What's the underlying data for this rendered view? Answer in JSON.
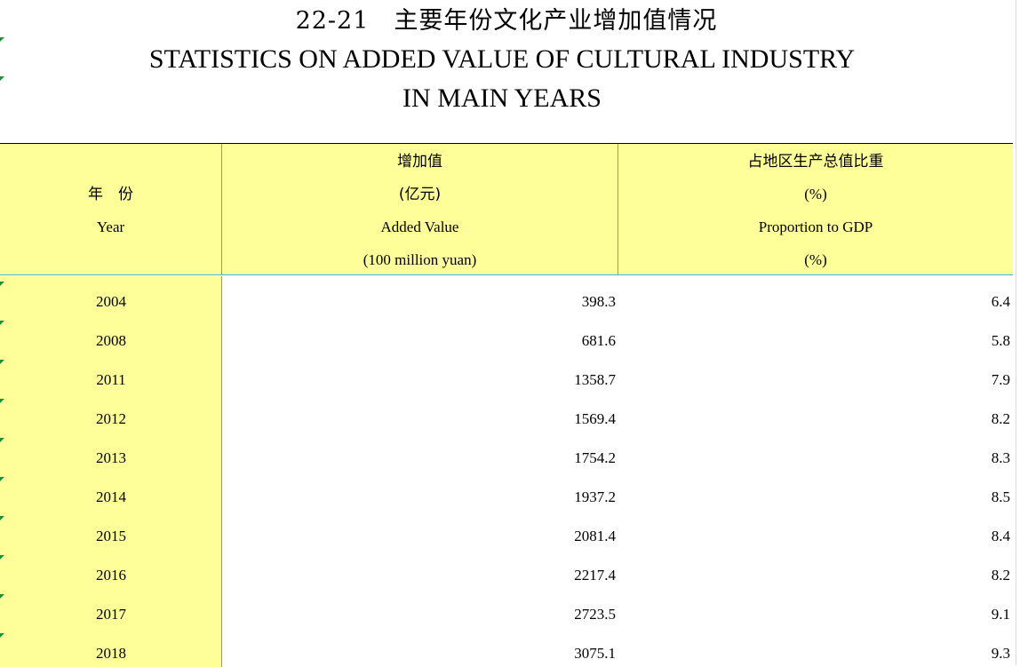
{
  "title": {
    "cn": "22-21　主要年份文化产业增加值情况",
    "en_line1": "STATISTICS ON ADDED VALUE OF CULTURAL INDUSTRY",
    "en_line2": "IN MAIN YEARS"
  },
  "header": {
    "year": {
      "cn": "年　份",
      "en": "Year"
    },
    "added_value": {
      "cn": "增加值",
      "cn_unit": "(亿元)",
      "en": "Added Value",
      "en_unit": "(100 million yuan)"
    },
    "proportion": {
      "cn": "占地区生产总值比重",
      "cn_unit": "(%)",
      "en": "Proportion to GDP",
      "en_unit": "(%)"
    }
  },
  "rows": [
    {
      "year": "2004",
      "added_value": "398.3",
      "proportion": "6.4"
    },
    {
      "year": "2008",
      "added_value": "681.6",
      "proportion": "5.8"
    },
    {
      "year": "2011",
      "added_value": "1358.7",
      "proportion": "7.9"
    },
    {
      "year": "2012",
      "added_value": "1569.4",
      "proportion": "8.2"
    },
    {
      "year": "2013",
      "added_value": "1754.2",
      "proportion": "8.3"
    },
    {
      "year": "2014",
      "added_value": "1937.2",
      "proportion": "8.5"
    },
    {
      "year": "2015",
      "added_value": "2081.4",
      "proportion": "8.4"
    },
    {
      "year": "2016",
      "added_value": "2217.4",
      "proportion": "8.2"
    },
    {
      "year": "2017",
      "added_value": "2723.5",
      "proportion": "9.1"
    },
    {
      "year": "2018",
      "added_value": "3075.1",
      "proportion": "9.3"
    }
  ],
  "colors": {
    "header_fill": "#ffff99",
    "grid_line": "#3fb6e6",
    "cell_marker": "#1e8f3a"
  }
}
